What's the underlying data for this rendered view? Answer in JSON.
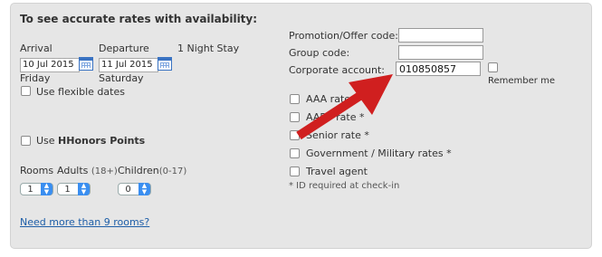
{
  "heading": "To see accurate rates with availability:",
  "arrival": {
    "label": "Arrival",
    "value": "10 Jul 2015",
    "day": "Friday"
  },
  "departure": {
    "label": "Departure",
    "value": "11 Jul 2015",
    "day": "Saturday"
  },
  "stay_length": "1 Night Stay",
  "flexible_dates_label": "Use flexible dates",
  "hhonors": {
    "label_prefix": "Use ",
    "label_bold": "HHonors Points"
  },
  "occupancy": {
    "rooms_label": "Rooms",
    "adults_label": "Adults",
    "adults_note": "(18+)",
    "children_label": "Children",
    "children_note": "(0-17)",
    "rooms_value": "1",
    "adults_value": "1",
    "children_value": "0"
  },
  "more_rooms_link": "Need more than 9 rooms?",
  "codes": {
    "promotion_label": "Promotion/Offer code:",
    "promotion_value": "",
    "group_label": "Group code:",
    "group_value": "",
    "corporate_label": "Corporate account:",
    "corporate_value": "010850857",
    "remember_label": "Remember me"
  },
  "rates": [
    {
      "label": "AAA rate"
    },
    {
      "label": "AARP rate *"
    },
    {
      "label": "Senior rate *"
    },
    {
      "label": "Government / Military rates *"
    },
    {
      "label": "Travel agent"
    }
  ],
  "id_note": "* ID required at check-in",
  "colors": {
    "arrow": "#d01f1f",
    "link": "#1f5fa8",
    "panel": "#e6e6e6",
    "select_accent": "#3a8ef0"
  }
}
